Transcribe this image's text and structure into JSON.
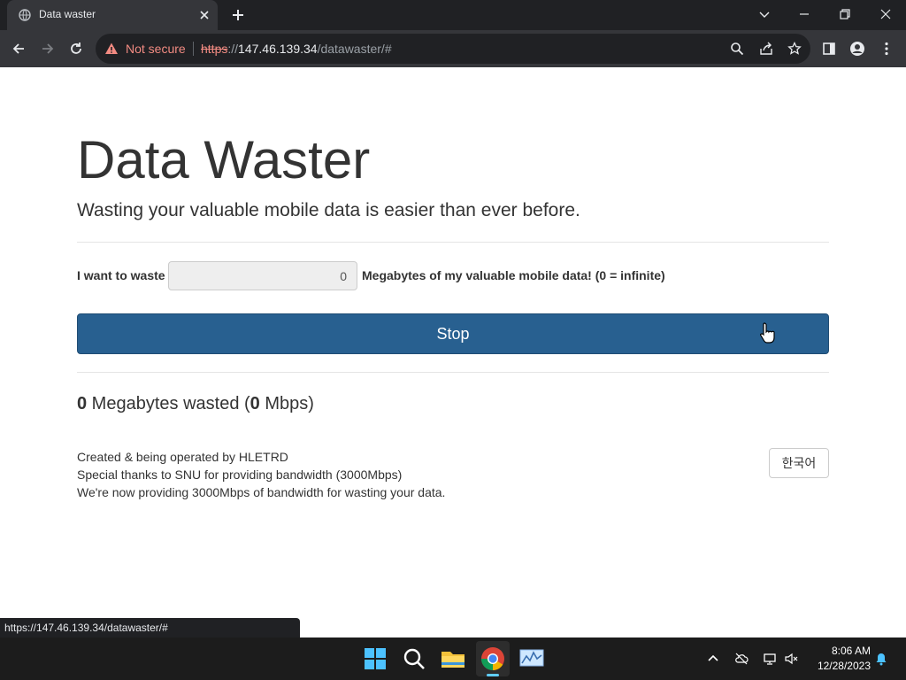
{
  "browser": {
    "tab_title": "Data waster",
    "security_label": "Not secure",
    "url_scheme": "https",
    "url_sep": "://",
    "url_host": "147.46.139.34",
    "url_path": "/datawaster/#",
    "status_url": "https://147.46.139.34/datawaster/#"
  },
  "page": {
    "title": "Data Waster",
    "lead": "Wasting your valuable mobile data is easier than ever before.",
    "want_label": "I want to waste",
    "mb_value": "0",
    "mb_suffix": "Megabytes of my valuable mobile data! (0 = infinite)",
    "stop_label": "Stop",
    "stats": {
      "mb_wasted": "0",
      "mb_text": " Megabytes wasted (",
      "mbps": "0",
      "mbps_text": " Mbps)"
    },
    "footer": [
      "Created & being operated by HLETRD",
      "Special thanks to SNU for providing bandwidth (3000Mbps)",
      "We're now providing 3000Mbps of bandwidth for wasting your data."
    ],
    "lang_button": "한국어"
  },
  "taskbar": {
    "time": "8:06 AM",
    "date": "12/28/2023"
  },
  "colors": {
    "primary": "#286090",
    "warning": "#f28b82"
  }
}
